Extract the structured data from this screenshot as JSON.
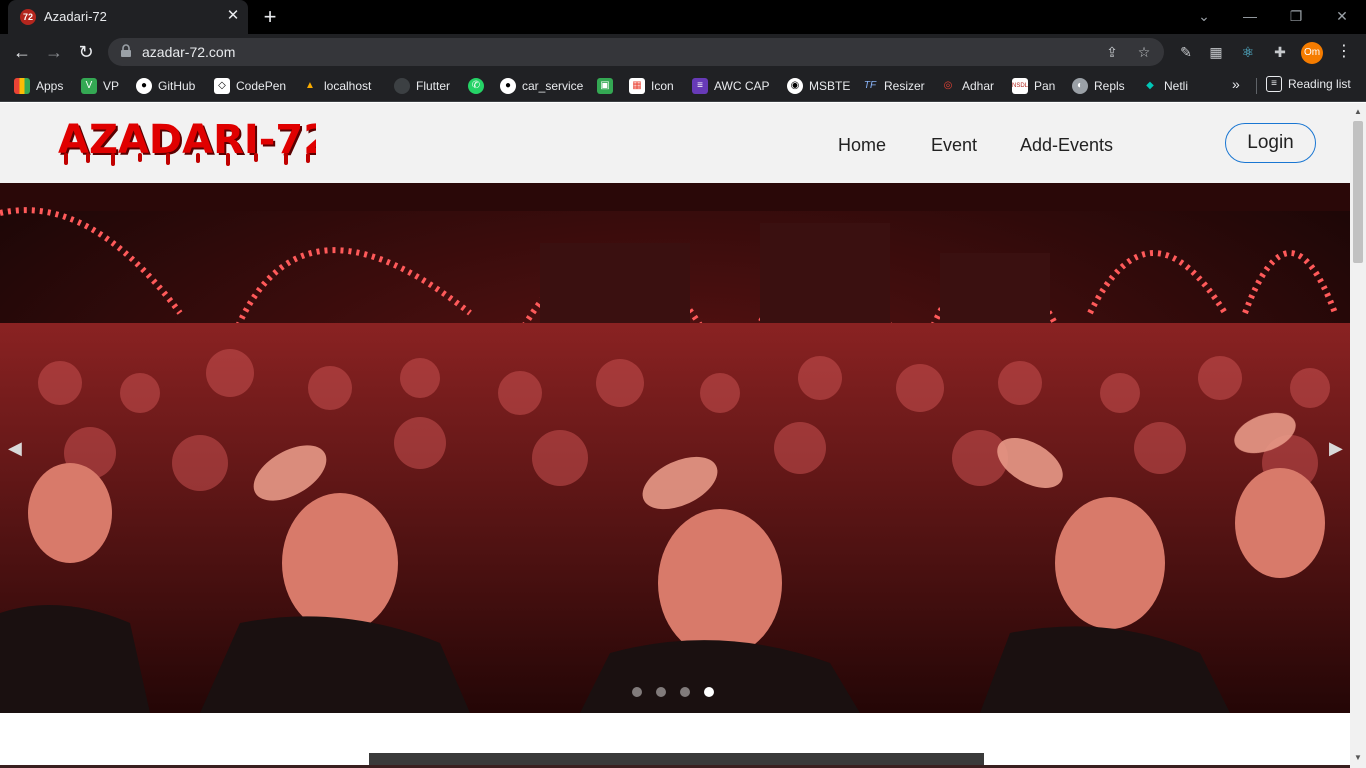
{
  "browser": {
    "tab": {
      "favicon_text": "72",
      "title": "Azadari-72"
    },
    "url": "azadar-72.com",
    "profile_initials": "Om",
    "bookmarks": [
      {
        "label": "Apps",
        "icon": "apps-grid-icon",
        "color": "#ea4335"
      },
      {
        "label": "VP",
        "icon": "vp-icon",
        "color": "#34a853"
      },
      {
        "label": "GitHub",
        "icon": "github-icon",
        "color": "#ffffff"
      },
      {
        "label": "CodePen",
        "icon": "codepen-icon",
        "color": "#ffffff"
      },
      {
        "label": "localhost",
        "icon": "localhost-icon",
        "color": "#f9ab00"
      },
      {
        "label": "Flutter",
        "icon": "flutter-icon",
        "color": "#5f6368"
      },
      {
        "label": "",
        "icon": "whatsapp-icon",
        "color": "#25d366"
      },
      {
        "label": "car_service",
        "icon": "github-icon",
        "color": "#ffffff"
      },
      {
        "label": "",
        "icon": "green-square-icon",
        "color": "#34a853"
      },
      {
        "label": "Icon",
        "icon": "icon-grid-icon",
        "color": "#ea4335"
      },
      {
        "label": "AWC CAP",
        "icon": "list-icon",
        "color": "#673ab7"
      },
      {
        "label": "MSBTE",
        "icon": "msbte-icon",
        "color": "#ffffff"
      },
      {
        "label": "Resizer",
        "icon": "resizer-icon",
        "color": "#1a73e8"
      },
      {
        "label": "Adhar",
        "icon": "aadhaar-icon",
        "color": "#ea4335"
      },
      {
        "label": "Pan",
        "icon": "nsdl-icon",
        "color": "#ffffff"
      },
      {
        "label": "Repls",
        "icon": "repl-icon",
        "color": "#9aa0a6"
      },
      {
        "label": "Netli",
        "icon": "netlify-icon",
        "color": "#00c7b7"
      }
    ],
    "reading_list": "Reading list"
  },
  "site": {
    "logo_text": "AZADARI-72",
    "nav": {
      "home": "Home",
      "event": "Event",
      "add_events": "Add-Events"
    },
    "login": "Login",
    "carousel": {
      "slide_count": 4,
      "active_index": 3
    }
  }
}
